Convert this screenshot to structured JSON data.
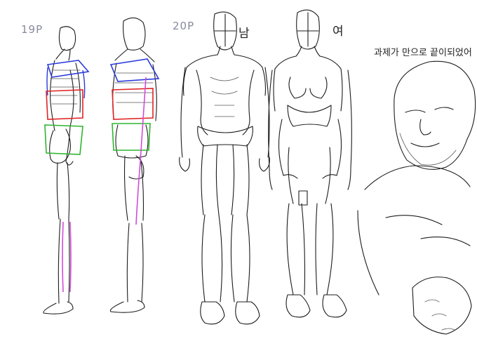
{
  "labels": {
    "page_19": "19P",
    "page_20": "20P",
    "male": "남",
    "female": "여",
    "note": "과제가 만으로 끝이되었어"
  },
  "colors": {
    "ink": "#1c1c1c",
    "ribcage_blue": "#2a3ad8",
    "ribcage_red": "#e02424",
    "pelvis_green": "#2fb52f",
    "leg_magenta": "#d14cd8",
    "label_gray": "#8a8aa0"
  }
}
